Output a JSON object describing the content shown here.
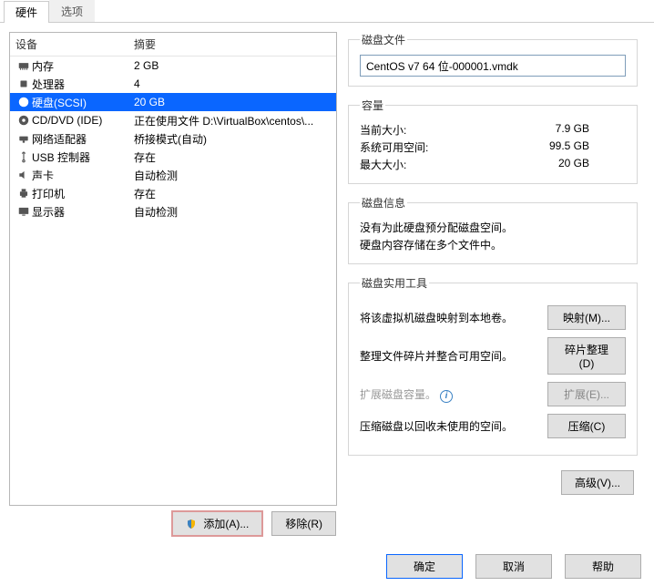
{
  "tabs": {
    "hardware": "硬件",
    "options": "选项"
  },
  "headers": {
    "device": "设备",
    "summary": "摘要"
  },
  "devices": [
    {
      "name": "内存",
      "summary": "2 GB",
      "icon": "memory"
    },
    {
      "name": "处理器",
      "summary": "4",
      "icon": "cpu"
    },
    {
      "name": "硬盘(SCSI)",
      "summary": "20 GB",
      "icon": "disk",
      "selected": true
    },
    {
      "name": "CD/DVD (IDE)",
      "summary": "正在使用文件 D:\\VirtualBox\\centos\\...",
      "icon": "cd"
    },
    {
      "name": "网络适配器",
      "summary": "桥接模式(自动)",
      "icon": "net"
    },
    {
      "name": "USB 控制器",
      "summary": "存在",
      "icon": "usb"
    },
    {
      "name": "声卡",
      "summary": "自动检测",
      "icon": "sound"
    },
    {
      "name": "打印机",
      "summary": "存在",
      "icon": "printer"
    },
    {
      "name": "显示器",
      "summary": "自动检测",
      "icon": "display"
    }
  ],
  "buttons": {
    "add": "添加(A)...",
    "remove": "移除(R)",
    "ok": "确定",
    "cancel": "取消",
    "help": "帮助",
    "advanced": "高级(V)..."
  },
  "diskfile": {
    "legend": "磁盘文件",
    "value": "CentOS v7 64 位-000001.vmdk"
  },
  "capacity": {
    "legend": "容量",
    "current_label": "当前大小:",
    "current_value": "7.9 GB",
    "free_label": "系统可用空间:",
    "free_value": "99.5 GB",
    "max_label": "最大大小:",
    "max_value": "20 GB"
  },
  "diskinfo": {
    "legend": "磁盘信息",
    "line1": "没有为此硬盘预分配磁盘空间。",
    "line2": "硬盘内容存储在多个文件中。"
  },
  "utils": {
    "legend": "磁盘实用工具",
    "map_text": "将该虚拟机磁盘映射到本地卷。",
    "map_btn": "映射(M)...",
    "defrag_text": "整理文件碎片并整合可用空间。",
    "defrag_btn": "碎片整理(D)",
    "expand_text": "扩展磁盘容量。",
    "expand_btn": "扩展(E)...",
    "compact_text": "压缩磁盘以回收未使用的空间。",
    "compact_btn": "压缩(C)"
  }
}
